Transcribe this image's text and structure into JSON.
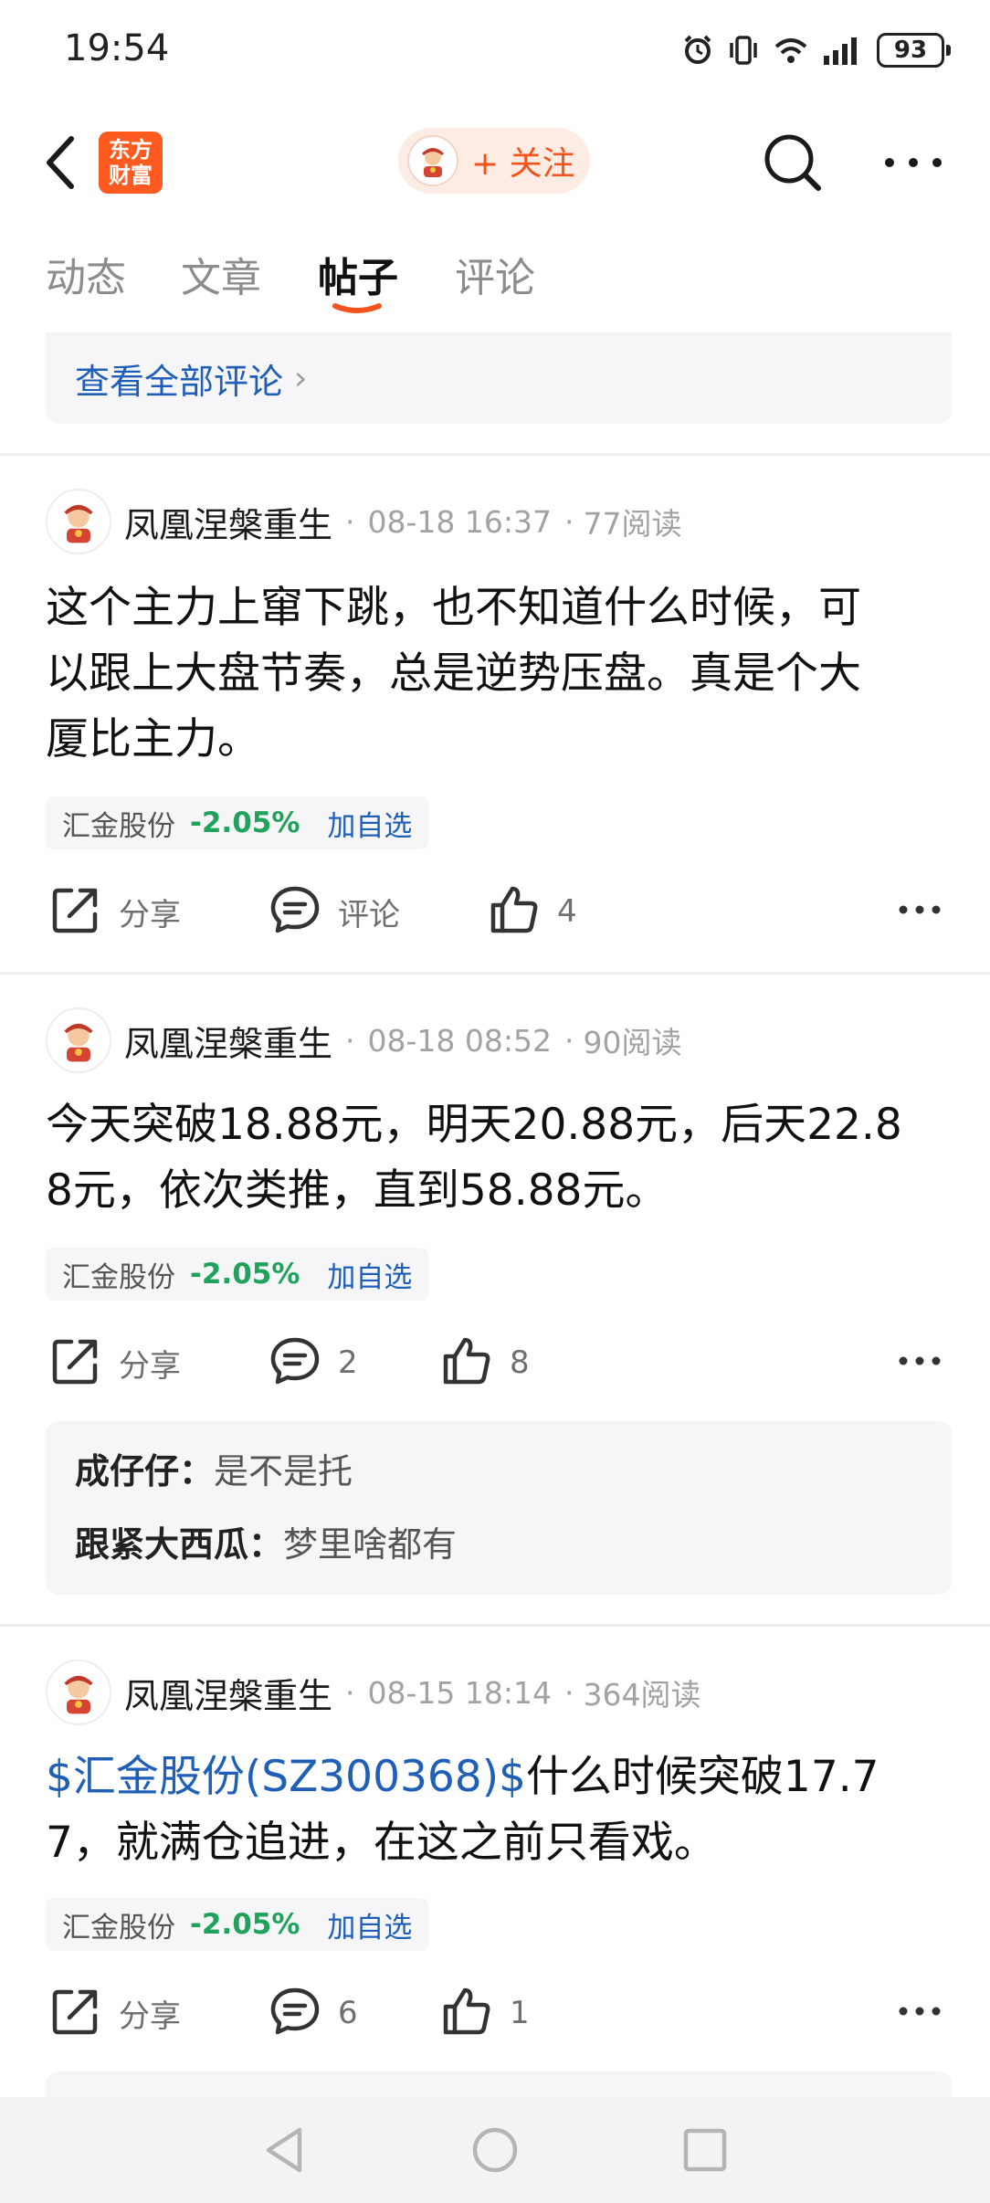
{
  "status_bar": {
    "time": "19:54",
    "battery": "93",
    "icons": [
      "alarm-icon",
      "vibrate-icon",
      "wifi-icon",
      "signal-icon",
      "battery-icon"
    ]
  },
  "header": {
    "logo_line1": "东方",
    "logo_line2": "财富",
    "follow_label": "+ 关注"
  },
  "tabs": [
    {
      "label": "动态",
      "active": false
    },
    {
      "label": "文章",
      "active": false
    },
    {
      "label": "帖子",
      "active": true
    },
    {
      "label": "评论",
      "active": false
    }
  ],
  "view_all_comments": "查看全部评论",
  "colors": {
    "accent": "#f2541b",
    "link": "#1f5fb8",
    "down": "#1fa25a"
  },
  "posts": [
    {
      "author": "凤凰涅槃重生",
      "time": "08-18 16:37",
      "reads": "77阅读",
      "body_line1": "这个主力上窜下跳，也不知道什么时候，可",
      "body_line2": "以跟上大盘节奏，总是逆势压盘。真是个大",
      "body_line3": "厦比主力。",
      "stock_name": "汇金股份",
      "stock_change": "-2.05%",
      "add_watch": "加自选",
      "share_label": "分享",
      "comment_label": "评论",
      "like_count": "4"
    },
    {
      "author": "凤凰涅槃重生",
      "time": "08-18 08:52",
      "reads": "90阅读",
      "body_line1": "今天突破18.88元，明天20.88元，后天22.8",
      "body_line2": "8元，依次类推，直到58.88元。",
      "stock_name": "汇金股份",
      "stock_change": "-2.05%",
      "add_watch": "加自选",
      "share_label": "分享",
      "comment_count": "2",
      "like_count": "8",
      "replies": [
        {
          "user": "成仔仔：",
          "text": "是不是托"
        },
        {
          "user": "跟紧大西瓜：",
          "text": "梦里啥都有"
        }
      ]
    },
    {
      "author": "凤凰涅槃重生",
      "time": "08-15 18:14",
      "reads": "364阅读",
      "body_link": "$汇金股份(SZ300368)$",
      "body_line1_rest": "什么时候突破17.7",
      "body_line2": "7，就满仓追进，在这之前只看戏。",
      "stock_name": "汇金股份",
      "stock_change": "-2.05%",
      "add_watch": "加自选",
      "share_label": "分享",
      "comment_count": "6",
      "like_count": "1"
    }
  ]
}
